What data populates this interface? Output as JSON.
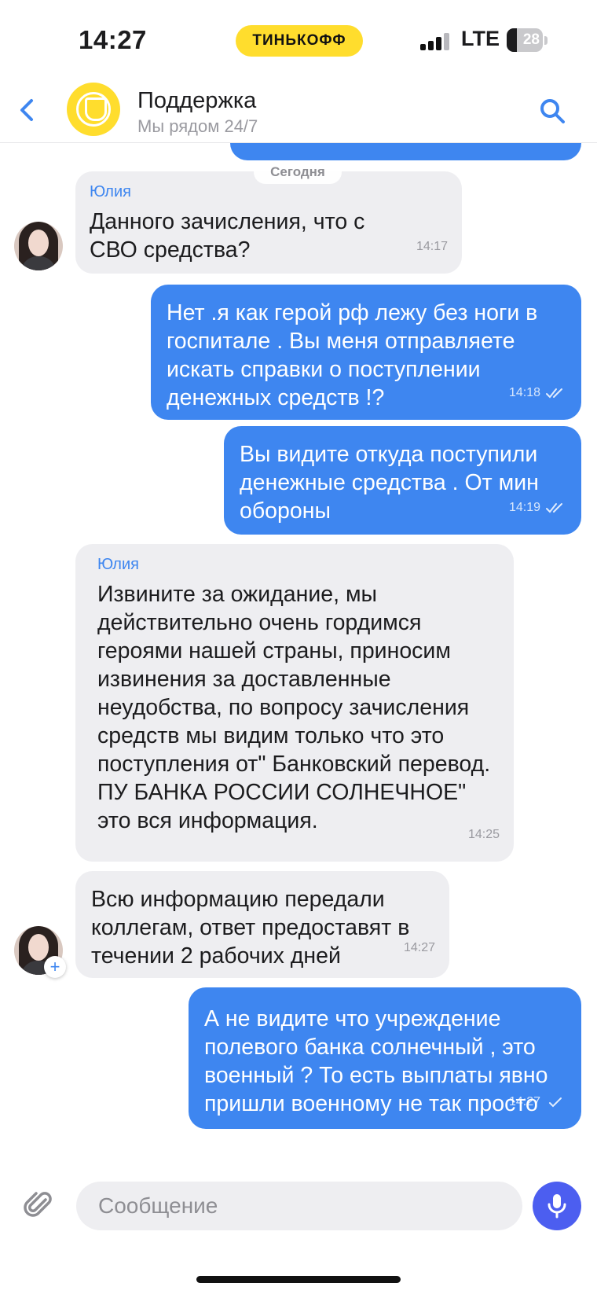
{
  "status_bar": {
    "time": "14:27",
    "carrier_pill": "ТИНЬКОФФ",
    "network": "LTE",
    "battery": "28",
    "battery_level": 0.28
  },
  "header": {
    "title": "Поддержка",
    "subtitle": "Мы рядом 24/7",
    "back_icon": "chevron-left-icon",
    "search_icon": "search-icon"
  },
  "chat": {
    "date_separator": "Сегодня",
    "messages": [
      {
        "direction": "incoming",
        "sender": "Юлия",
        "text": "Данного зачисления, что с СВО средства?",
        "time": "14:17"
      },
      {
        "direction": "outgoing",
        "text": "Нет .я как герой рф лежу без ноги в госпитале . Вы меня отправляете искать справки о поступлении денежных средств !?",
        "time": "14:18",
        "status": "read"
      },
      {
        "direction": "outgoing",
        "text": "Вы  видите откуда поступили денежные средства . От мин обороны",
        "time": "14:19",
        "status": "read"
      },
      {
        "direction": "incoming",
        "sender": "Юлия",
        "text": "Извините за ожидание, мы действительно очень гордимся героями нашей страны, приносим извинения за доставленные неудобства,  по вопросу зачисления средств мы видим только что это поступления от\" Банковский перевод. ПУ БАНКА РОССИИ СОЛНЕЧНОЕ\" это вся информация.",
        "time": "14:25"
      },
      {
        "direction": "incoming",
        "text": "Всю информацию передали коллегам, ответ предоставят в течении 2 рабочих дней",
        "time": "14:27"
      },
      {
        "direction": "outgoing",
        "text": "А не видите что учреждение полевого банка солнечный , это военный ? То есть выплаты явно пришли военному не так просто",
        "time": "14:27",
        "status": "sent"
      }
    ]
  },
  "composer": {
    "placeholder": "Сообщение",
    "attach_icon": "paperclip-icon",
    "mic_icon": "microphone-icon"
  },
  "colors": {
    "accent": "#3e86f0",
    "brand_yellow": "#ffdd2d",
    "incoming_bubble": "#eeeef1",
    "mic_button": "#4c5ef0"
  }
}
